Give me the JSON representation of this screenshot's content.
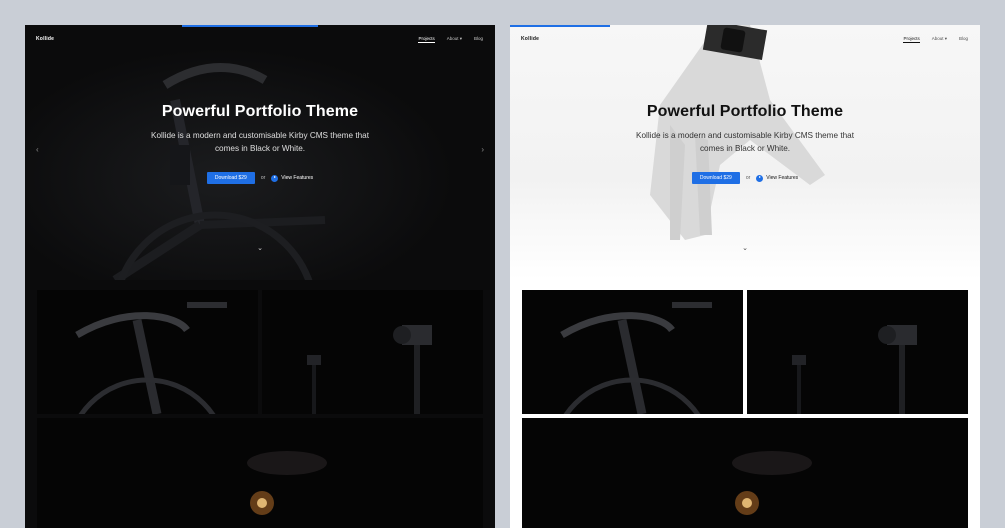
{
  "panels": {
    "dark": {
      "logo": "Kollide",
      "nav": [
        "Projects",
        "About ▾",
        "Blog"
      ],
      "hero": {
        "title": "Powerful Portfolio Theme",
        "text": "Kollide is a modern and customisable Kirby CMS theme that comes in Black or White.",
        "download_label": "Download $29",
        "or_text": "or",
        "features_label": "View Features"
      }
    },
    "light": {
      "logo": "Kollide",
      "nav": [
        "Projects",
        "About ▾",
        "Blog"
      ],
      "hero": {
        "title": "Powerful Portfolio Theme",
        "text": "Kollide is a modern and customisable Kirby CMS theme that comes in Black or White.",
        "download_label": "Download $29",
        "or_text": "or",
        "features_label": "View Features"
      }
    }
  },
  "icons": {
    "scroll_down": "chevron-double-down-icon",
    "play": "play-icon",
    "prev": "chevron-left-icon",
    "next": "chevron-right-icon"
  },
  "colors": {
    "accent": "#1f6fe5",
    "dark_bg": "#0b0b0c",
    "light_bg": "#ffffff",
    "page_bg": "#c9ced6"
  }
}
